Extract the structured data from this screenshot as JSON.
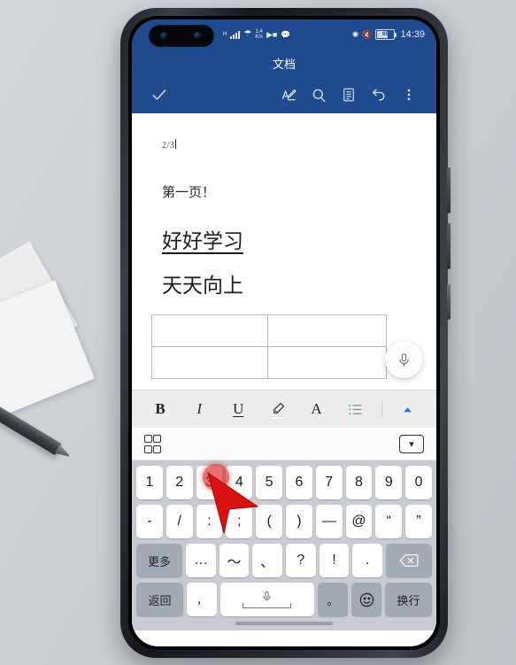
{
  "statusbar": {
    "network_type": "H",
    "net_speed_value": "1.4",
    "net_speed_unit": "K/s",
    "wifi_icon": "wifi-icon",
    "signal_icon": "signal-bars-icon",
    "video_icon": "video-camera-icon",
    "message_icon": "chat-bubble-icon",
    "bluetooth_icon": "bluetooth-icon",
    "mute_icon": "mute-icon",
    "battery_percent": "65",
    "clock": "14:39"
  },
  "header": {
    "title": "文档",
    "confirm_icon": "check-icon",
    "tools": [
      {
        "name": "pen-edit-icon",
        "label": "编辑"
      },
      {
        "name": "search-icon",
        "label": "搜索"
      },
      {
        "name": "document-outline-icon",
        "label": "大纲"
      },
      {
        "name": "undo-icon",
        "label": "撤销"
      },
      {
        "name": "more-vertical-icon",
        "label": "更多"
      }
    ]
  },
  "document": {
    "page_number": "2/3",
    "line1": "第一页！",
    "heading1": "好好学习",
    "heading2": "天天向上",
    "table": {
      "rows": 2,
      "cols": 2,
      "cells": [
        [
          "",
          ""
        ],
        [
          "",
          ""
        ]
      ]
    },
    "mic_fab": "microphone-icon"
  },
  "formatbar": {
    "buttons": [
      {
        "name": "bold-button",
        "label": "B"
      },
      {
        "name": "italic-button",
        "label": "I"
      },
      {
        "name": "underline-button",
        "label": "U"
      },
      {
        "name": "highlighter-button",
        "label": ""
      },
      {
        "name": "font-color-button",
        "label": "A"
      },
      {
        "name": "bullet-list-button",
        "label": ""
      },
      {
        "name": "collapse-toolbar-button",
        "label": "▲"
      }
    ],
    "highlight_color": "#ffffff",
    "font_color": "#d61c1c",
    "chevron_color": "#1f6fd0"
  },
  "keyboard": {
    "toolbar": {
      "apps_grid_icon": "apps-grid-icon",
      "hide_keyboard_icon": "chevron-down-icon"
    },
    "row_numbers": [
      "1",
      "2",
      "3",
      "4",
      "5",
      "6",
      "7",
      "8",
      "9",
      "0"
    ],
    "row_symbols": [
      "-",
      "/",
      ":",
      ";",
      "(",
      ")",
      "—",
      "@",
      "“",
      "”"
    ],
    "row_more": {
      "more_label": "更多",
      "keys": [
        "…",
        "～",
        "、",
        "?",
        "!",
        "."
      ],
      "backspace_icon": "backspace-icon"
    },
    "row_bottom": {
      "return_label": "返回",
      "comma": "，",
      "space_mic_icon": "microphone-icon",
      "period": "。",
      "emoji_icon": "smiley-icon",
      "newline_label": "换行"
    }
  },
  "overlay": {
    "tap_target_key": "3",
    "tap_color": "#dc1919",
    "cursor": "arrow-cursor"
  },
  "colors": {
    "app_blue": "#1f4b8e",
    "keyboard_bg": "#c8ccd2",
    "key_white": "#ffffff",
    "key_gray": "#a4aab4"
  }
}
